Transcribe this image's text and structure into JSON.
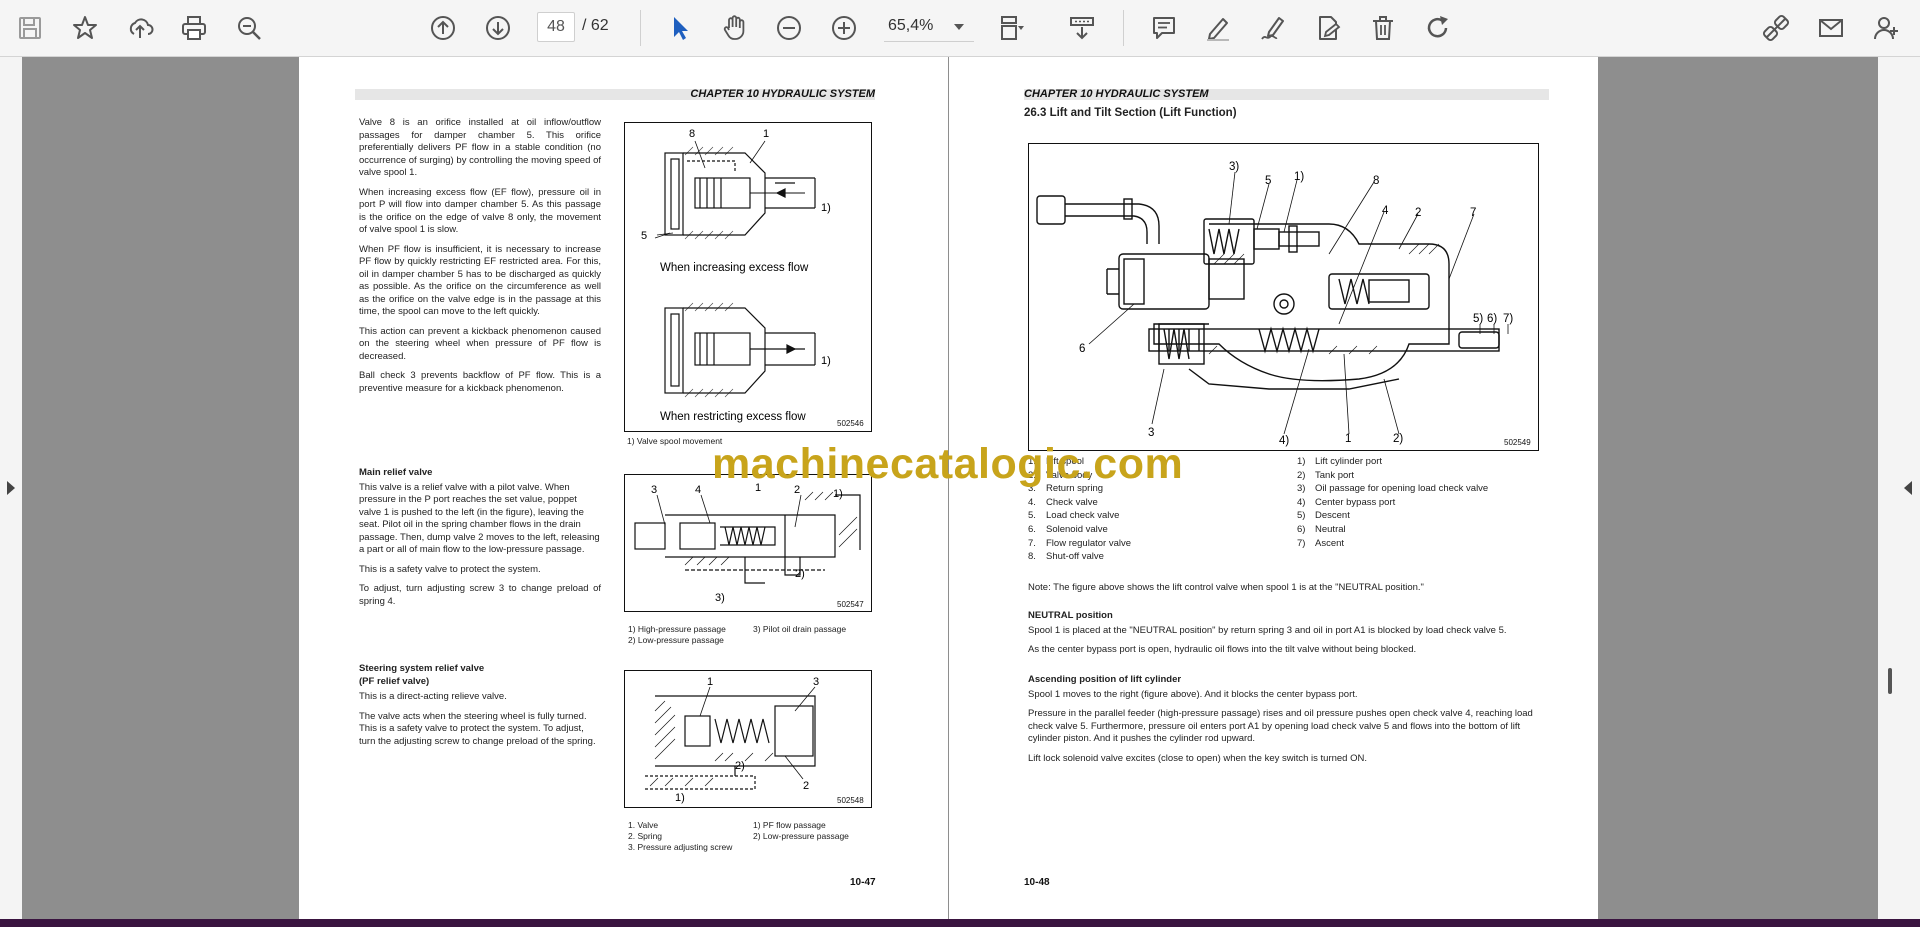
{
  "toolbar": {
    "page_current": "48",
    "page_total": "/  62",
    "zoom": "65,4%",
    "icons": [
      "save-icon",
      "bookmark-star-icon",
      "upload-cloud-icon",
      "print-icon",
      "zoom-search-icon",
      "previous-page-icon",
      "next-page-icon",
      "select-cursor-icon",
      "hand-tool-icon",
      "zoom-out-icon",
      "zoom-in-icon",
      "page-fit-icon",
      "scroll-mode-icon",
      "comment-icon",
      "highlight-pen-icon",
      "sign-icon",
      "edit-document-icon",
      "delete-icon",
      "redo-icon",
      "share-link-icon",
      "email-icon",
      "add-user-icon"
    ]
  },
  "left_page": {
    "chapter": "CHAPTER 10 HYDRAULIC SYSTEM",
    "intro_paragraphs": [
      "Valve 8 is an orifice installed at oil inflow/outflow passages for damper chamber 5. This orifice preferentially delivers PF flow in a stable condition (no occurrence of surging) by controlling the moving speed of valve spool 1.",
      "When increasing excess flow (EF flow), pressure oil in port P will flow into damper chamber 5. As this passage is the orifice on the edge of valve 8 only, the movement of valve spool 1 is slow.",
      "When PF flow is insufficient, it is necessary to increase PF flow by quickly restricting EF restricted area. For this, oil in damper chamber 5 has to be discharged as quickly as possible. As the orifice on the circumference as well as the orifice on the valve edge is in the passage at this time, the spool can move to the left quickly.",
      "This action can prevent a kickback phenomenon caused on the steering wheel when pressure of PF flow is decreased.",
      "Ball check 3 prevents backflow of PF flow. This is a preventive measure for a kickback phenomenon."
    ],
    "fig1": {
      "label_top": "When increasing excess flow",
      "label_bottom": "When restricting excess flow",
      "code": "502546",
      "caption": "1) Valve spool movement",
      "callouts": [
        "8",
        "1",
        "5",
        "1)",
        "1)"
      ]
    },
    "main_relief": {
      "heading": "Main relief valve",
      "paragraphs": [
        "This valve is a relief valve with a pilot valve. When pressure in the P port reaches the set value, poppet valve 1 is pushed to the left (in the figure), leaving the seat. Pilot oil in the spring chamber flows in the drain passage. Then, dump valve 2 moves to the left, releasing a part or all of main flow to the low-pressure passage.",
        "This is a safety valve to protect the system.",
        "To adjust, turn adjusting screw 3 to change preload of spring 4."
      ]
    },
    "fig2": {
      "code": "502547",
      "callouts": [
        "3",
        "4",
        "1",
        "2",
        "1)",
        "2)",
        "3)"
      ],
      "caption_col1": [
        "1) High-pressure passage",
        "2) Low-pressure passage"
      ],
      "caption_col2": [
        "3) Pilot oil drain passage"
      ]
    },
    "steering_relief": {
      "heading1": "Steering system relief valve",
      "heading2": "(PF relief valve)",
      "paragraphs": [
        "This is a direct-acting relieve valve.",
        "The valve acts when the steering wheel is fully turned. This is a safety valve to protect the system. To adjust, turn the adjusting screw to change preload of the spring."
      ]
    },
    "fig3": {
      "code": "502548",
      "callouts": [
        "1",
        "3",
        "2)",
        "2",
        "1)"
      ],
      "caption_col1": [
        "1. Valve",
        "2. Spring",
        "3. Pressure adjusting screw"
      ],
      "caption_col2": [
        "1) PF flow passage",
        "2) Low-pressure passage"
      ]
    },
    "page_number": "10-47"
  },
  "right_page": {
    "chapter": "CHAPTER 10 HYDRAULIC SYSTEM",
    "section_title": "26.3    Lift and Tilt Section (Lift Function)",
    "fig": {
      "code": "502549",
      "callouts": [
        "3)",
        "5",
        "1)",
        "8",
        "4",
        "2",
        "7",
        "6",
        "5)",
        "6)",
        "7)",
        "3",
        "4)",
        "1",
        "2)"
      ]
    },
    "legend_left": [
      {
        "num": "1.",
        "label": "Lift spool"
      },
      {
        "num": "2.",
        "label": "Valve body"
      },
      {
        "num": "3.",
        "label": "Return spring"
      },
      {
        "num": "4.",
        "label": "Check valve"
      },
      {
        "num": "5.",
        "label": "Load check valve"
      },
      {
        "num": "6.",
        "label": "Solenoid valve"
      },
      {
        "num": "7.",
        "label": "Flow regulator valve"
      },
      {
        "num": "8.",
        "label": "Shut-off valve"
      }
    ],
    "legend_right": [
      {
        "num": "1)",
        "label": "Lift cylinder port"
      },
      {
        "num": "2)",
        "label": "Tank port"
      },
      {
        "num": "3)",
        "label": "Oil passage for opening load check valve"
      },
      {
        "num": "4)",
        "label": "Center bypass port"
      },
      {
        "num": "5)",
        "label": "Descent"
      },
      {
        "num": "6)",
        "label": "Neutral"
      },
      {
        "num": "7)",
        "label": "Ascent"
      }
    ],
    "note": "Note: The figure above shows the lift control valve when spool 1 is at the \"NEUTRAL position.\"",
    "neutral": {
      "heading": "NEUTRAL position",
      "paragraphs": [
        "Spool 1 is placed at the \"NEUTRAL position\" by return spring 3 and oil in port A1 is blocked by load check valve 5.",
        "As the center bypass port is open, hydraulic oil flows into the tilt valve without being blocked."
      ]
    },
    "ascending": {
      "heading": "Ascending position of lift cylinder",
      "paragraphs": [
        "Spool 1 moves to the right (figure above). And it blocks the center bypass port.",
        "Pressure in the parallel feeder (high-pressure passage) rises and oil pressure pushes open check valve 4, reaching load check valve 5. Furthermore, pressure oil enters port A1 by opening load check valve 5 and flows into the bottom of lift cylinder piston. And it pushes the cylinder rod upward.",
        "Lift lock solenoid valve excites (close to open) when the key switch is turned ON."
      ]
    },
    "page_number": "10-48"
  },
  "watermark": "machinecatalogic.com"
}
